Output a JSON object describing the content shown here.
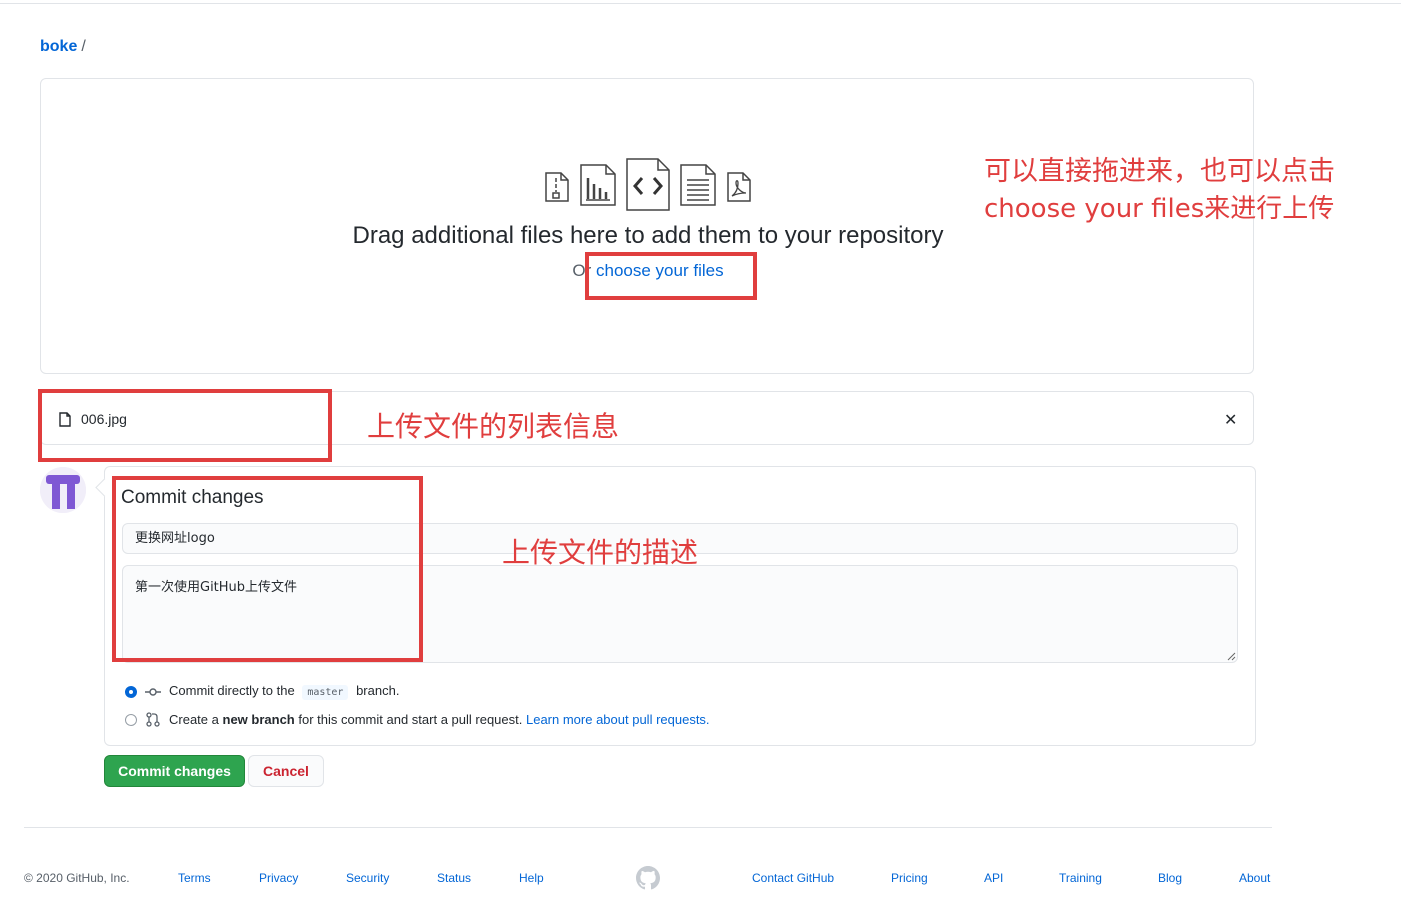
{
  "breadcrumb": {
    "repo": "boke",
    "separator": "/"
  },
  "dropzone": {
    "title": "Drag additional files here to add them to your repository",
    "or_text": "Or",
    "choose_link": "choose your files",
    "icons": [
      "file-zip-icon",
      "file-chart-icon",
      "file-code-icon",
      "file-text-icon",
      "file-pdf-icon"
    ]
  },
  "files": [
    {
      "name": "006.jpg",
      "icon": "file-icon"
    }
  ],
  "commit": {
    "title": "Commit changes",
    "summary_value": "更换网址logo",
    "description_value": "第一次使用GitHub上传文件",
    "option_direct": {
      "prefix": "Commit directly to the",
      "branch": "master",
      "suffix": "branch."
    },
    "option_new": {
      "prefix": "Create a",
      "bold": "new branch",
      "middle": "for this commit and start a pull request.",
      "link": "Learn more about pull requests."
    },
    "commit_button": "Commit changes",
    "cancel_button": "Cancel"
  },
  "footer": {
    "copyright": "© 2020 GitHub, Inc.",
    "links_left": [
      "Terms",
      "Privacy",
      "Security",
      "Status",
      "Help"
    ],
    "links_right": [
      "Contact GitHub",
      "Pricing",
      "API",
      "Training",
      "Blog",
      "About"
    ]
  },
  "annotations": {
    "drag_note_line1": "可以直接拖进来，也可以点击",
    "drag_note_line2": "choose your files来进行上传",
    "file_list_note": "上传文件的列表信息",
    "description_note": "上传文件的描述"
  },
  "colors": {
    "link": "#0366d6",
    "commit_button": "#2ea44f",
    "cancel_text": "#cb2431",
    "annotation_red": "#e03e3e"
  }
}
